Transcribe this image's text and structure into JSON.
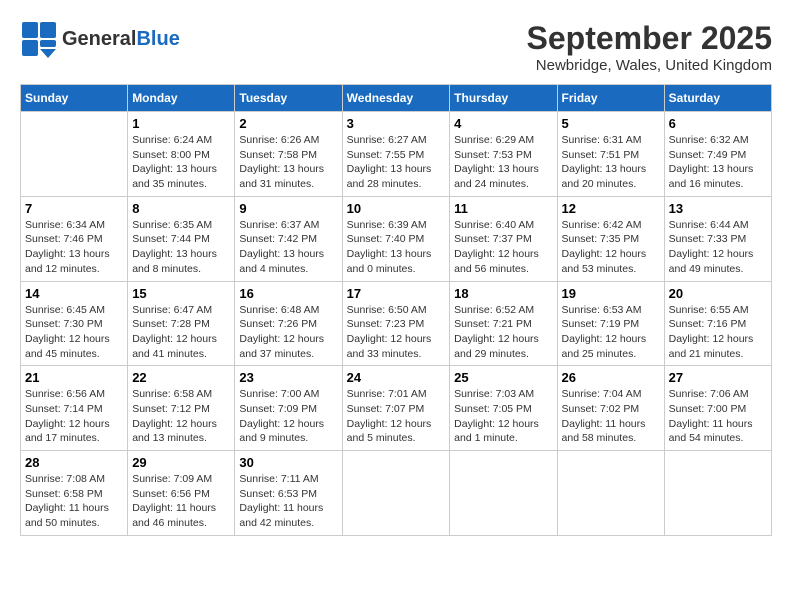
{
  "header": {
    "logo_general": "General",
    "logo_blue": "Blue",
    "month_year": "September 2025",
    "location": "Newbridge, Wales, United Kingdom"
  },
  "weekdays": [
    "Sunday",
    "Monday",
    "Tuesday",
    "Wednesday",
    "Thursday",
    "Friday",
    "Saturday"
  ],
  "weeks": [
    [
      {
        "day": "",
        "empty": true
      },
      {
        "day": "1",
        "sunrise": "Sunrise: 6:24 AM",
        "sunset": "Sunset: 8:00 PM",
        "daylight": "Daylight: 13 hours and 35 minutes."
      },
      {
        "day": "2",
        "sunrise": "Sunrise: 6:26 AM",
        "sunset": "Sunset: 7:58 PM",
        "daylight": "Daylight: 13 hours and 31 minutes."
      },
      {
        "day": "3",
        "sunrise": "Sunrise: 6:27 AM",
        "sunset": "Sunset: 7:55 PM",
        "daylight": "Daylight: 13 hours and 28 minutes."
      },
      {
        "day": "4",
        "sunrise": "Sunrise: 6:29 AM",
        "sunset": "Sunset: 7:53 PM",
        "daylight": "Daylight: 13 hours and 24 minutes."
      },
      {
        "day": "5",
        "sunrise": "Sunrise: 6:31 AM",
        "sunset": "Sunset: 7:51 PM",
        "daylight": "Daylight: 13 hours and 20 minutes."
      },
      {
        "day": "6",
        "sunrise": "Sunrise: 6:32 AM",
        "sunset": "Sunset: 7:49 PM",
        "daylight": "Daylight: 13 hours and 16 minutes."
      }
    ],
    [
      {
        "day": "7",
        "sunrise": "Sunrise: 6:34 AM",
        "sunset": "Sunset: 7:46 PM",
        "daylight": "Daylight: 13 hours and 12 minutes."
      },
      {
        "day": "8",
        "sunrise": "Sunrise: 6:35 AM",
        "sunset": "Sunset: 7:44 PM",
        "daylight": "Daylight: 13 hours and 8 minutes."
      },
      {
        "day": "9",
        "sunrise": "Sunrise: 6:37 AM",
        "sunset": "Sunset: 7:42 PM",
        "daylight": "Daylight: 13 hours and 4 minutes."
      },
      {
        "day": "10",
        "sunrise": "Sunrise: 6:39 AM",
        "sunset": "Sunset: 7:40 PM",
        "daylight": "Daylight: 13 hours and 0 minutes."
      },
      {
        "day": "11",
        "sunrise": "Sunrise: 6:40 AM",
        "sunset": "Sunset: 7:37 PM",
        "daylight": "Daylight: 12 hours and 56 minutes."
      },
      {
        "day": "12",
        "sunrise": "Sunrise: 6:42 AM",
        "sunset": "Sunset: 7:35 PM",
        "daylight": "Daylight: 12 hours and 53 minutes."
      },
      {
        "day": "13",
        "sunrise": "Sunrise: 6:44 AM",
        "sunset": "Sunset: 7:33 PM",
        "daylight": "Daylight: 12 hours and 49 minutes."
      }
    ],
    [
      {
        "day": "14",
        "sunrise": "Sunrise: 6:45 AM",
        "sunset": "Sunset: 7:30 PM",
        "daylight": "Daylight: 12 hours and 45 minutes."
      },
      {
        "day": "15",
        "sunrise": "Sunrise: 6:47 AM",
        "sunset": "Sunset: 7:28 PM",
        "daylight": "Daylight: 12 hours and 41 minutes."
      },
      {
        "day": "16",
        "sunrise": "Sunrise: 6:48 AM",
        "sunset": "Sunset: 7:26 PM",
        "daylight": "Daylight: 12 hours and 37 minutes."
      },
      {
        "day": "17",
        "sunrise": "Sunrise: 6:50 AM",
        "sunset": "Sunset: 7:23 PM",
        "daylight": "Daylight: 12 hours and 33 minutes."
      },
      {
        "day": "18",
        "sunrise": "Sunrise: 6:52 AM",
        "sunset": "Sunset: 7:21 PM",
        "daylight": "Daylight: 12 hours and 29 minutes."
      },
      {
        "day": "19",
        "sunrise": "Sunrise: 6:53 AM",
        "sunset": "Sunset: 7:19 PM",
        "daylight": "Daylight: 12 hours and 25 minutes."
      },
      {
        "day": "20",
        "sunrise": "Sunrise: 6:55 AM",
        "sunset": "Sunset: 7:16 PM",
        "daylight": "Daylight: 12 hours and 21 minutes."
      }
    ],
    [
      {
        "day": "21",
        "sunrise": "Sunrise: 6:56 AM",
        "sunset": "Sunset: 7:14 PM",
        "daylight": "Daylight: 12 hours and 17 minutes."
      },
      {
        "day": "22",
        "sunrise": "Sunrise: 6:58 AM",
        "sunset": "Sunset: 7:12 PM",
        "daylight": "Daylight: 12 hours and 13 minutes."
      },
      {
        "day": "23",
        "sunrise": "Sunrise: 7:00 AM",
        "sunset": "Sunset: 7:09 PM",
        "daylight": "Daylight: 12 hours and 9 minutes."
      },
      {
        "day": "24",
        "sunrise": "Sunrise: 7:01 AM",
        "sunset": "Sunset: 7:07 PM",
        "daylight": "Daylight: 12 hours and 5 minutes."
      },
      {
        "day": "25",
        "sunrise": "Sunrise: 7:03 AM",
        "sunset": "Sunset: 7:05 PM",
        "daylight": "Daylight: 12 hours and 1 minute."
      },
      {
        "day": "26",
        "sunrise": "Sunrise: 7:04 AM",
        "sunset": "Sunset: 7:02 PM",
        "daylight": "Daylight: 11 hours and 58 minutes."
      },
      {
        "day": "27",
        "sunrise": "Sunrise: 7:06 AM",
        "sunset": "Sunset: 7:00 PM",
        "daylight": "Daylight: 11 hours and 54 minutes."
      }
    ],
    [
      {
        "day": "28",
        "sunrise": "Sunrise: 7:08 AM",
        "sunset": "Sunset: 6:58 PM",
        "daylight": "Daylight: 11 hours and 50 minutes."
      },
      {
        "day": "29",
        "sunrise": "Sunrise: 7:09 AM",
        "sunset": "Sunset: 6:56 PM",
        "daylight": "Daylight: 11 hours and 46 minutes."
      },
      {
        "day": "30",
        "sunrise": "Sunrise: 7:11 AM",
        "sunset": "Sunset: 6:53 PM",
        "daylight": "Daylight: 11 hours and 42 minutes."
      },
      {
        "day": "",
        "empty": true
      },
      {
        "day": "",
        "empty": true
      },
      {
        "day": "",
        "empty": true
      },
      {
        "day": "",
        "empty": true
      }
    ]
  ]
}
